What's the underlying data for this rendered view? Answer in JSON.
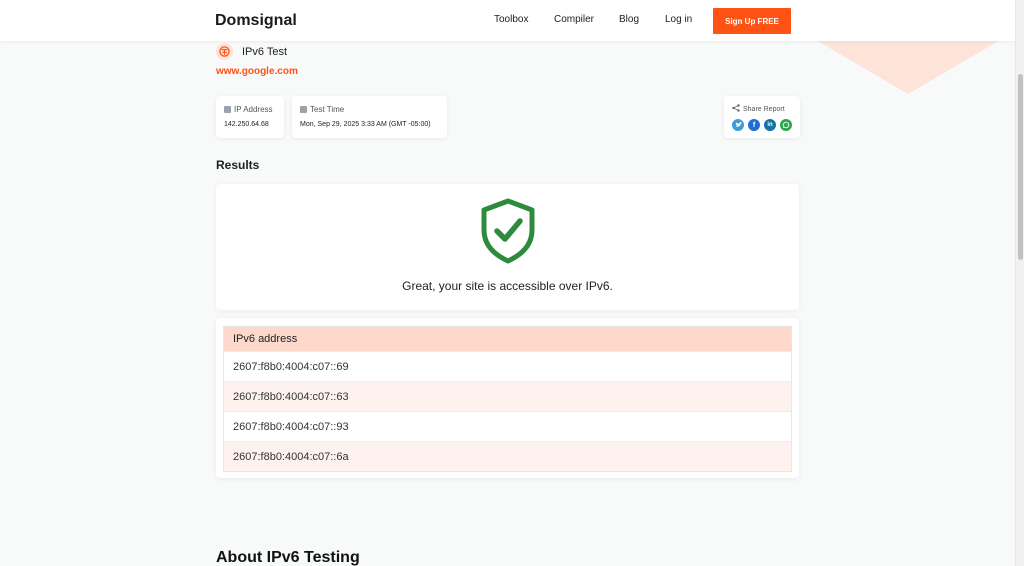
{
  "brand": {
    "logo_text": "Domsignal",
    "accent": "#ff5215"
  },
  "nav": {
    "links": [
      "Toolbox",
      "Compiler",
      "Blog",
      "Log in"
    ],
    "signup_label": "Sign Up FREE"
  },
  "test": {
    "title": "IPv6 Test",
    "site": "www.google.com"
  },
  "info": {
    "ip_label": "IP Address",
    "ip_value": "142.250.64.68",
    "time_label": "Test Time",
    "time_value": "Mon, Sep 29, 2025 3:33 AM (GMT -05:00)"
  },
  "share": {
    "label": "Share Report",
    "networks": [
      "twitter-icon",
      "facebook-icon",
      "linkedin-icon",
      "whatsapp-icon"
    ]
  },
  "results": {
    "heading": "Results",
    "message": "Great, your site is accessible over IPv6.",
    "status_icon": "shield-check-icon",
    "status_color": "#2e8b3e"
  },
  "ip_table": {
    "header": "IPv6 address",
    "rows": [
      "2607:f8b0:4004:c07::69",
      "2607:f8b0:4004:c07::63",
      "2607:f8b0:4004:c07::93",
      "2607:f8b0:4004:c07::6a"
    ]
  },
  "about": {
    "heading": "About IPv6 Testing"
  }
}
